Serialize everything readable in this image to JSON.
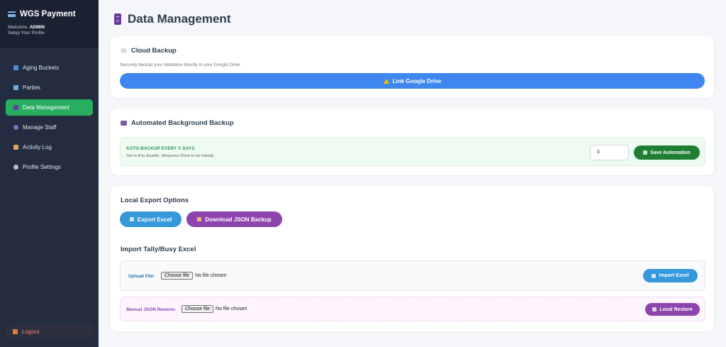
{
  "sidebar": {
    "brand": "WGS Payment",
    "welcome_prefix": "Welcome,",
    "user": "ADMIN",
    "setup_link": "Setup Your Profile",
    "items": [
      {
        "label": "Aging Buckets",
        "icon": "bar-chart-icon",
        "color": "#4a90d9"
      },
      {
        "label": "Parties",
        "icon": "building-icon",
        "color": "#6fa8dc"
      },
      {
        "label": "Data Management",
        "icon": "file-cabinet-icon",
        "color": "#6a3d9a",
        "active": true
      },
      {
        "label": "Manage Staff",
        "icon": "user-icon",
        "color": "#8e6bbf"
      },
      {
        "label": "Activity Log",
        "icon": "scroll-icon",
        "color": "#e0a458"
      },
      {
        "label": "Profile Settings",
        "icon": "gear-icon",
        "color": "#b8c2cc"
      }
    ],
    "logout": "Logout"
  },
  "page": {
    "title": "Data Management"
  },
  "cloud": {
    "heading": "Cloud Backup",
    "description": "Securely backup your database directly to your Google Drive.",
    "button": "Link Google Drive"
  },
  "automated": {
    "heading": "Automated Background Backup",
    "label": "AUTO-BACKUP EVERY X DAYS",
    "sub_prefix": "Set to",
    "sub_value": "0",
    "sub_suffix": "to disable. (Requires Drive to be linked).",
    "input_value": "0",
    "save_button": "Save Automation"
  },
  "local": {
    "heading": "Local Export Options",
    "export_button": "Export Excel",
    "json_button": "Download JSON Backup"
  },
  "import": {
    "heading": "Import Tally/Busy Excel",
    "upload_label": "Upload File:",
    "choose_file": "Choose file",
    "no_file": "No file chosen",
    "import_button": "Import Excel",
    "restore_label": "Manual JSON Restore:",
    "restore_choose": "Choose file",
    "restore_no_file": "No file chosen",
    "restore_button": "Local Restore"
  },
  "colors": {
    "sidebar_bg": "#232d3f",
    "active_green": "#27ae60",
    "google_blue": "#3f86ee",
    "save_green": "#1e7e34",
    "export_blue": "#3498db",
    "json_purple": "#8e44ad"
  }
}
